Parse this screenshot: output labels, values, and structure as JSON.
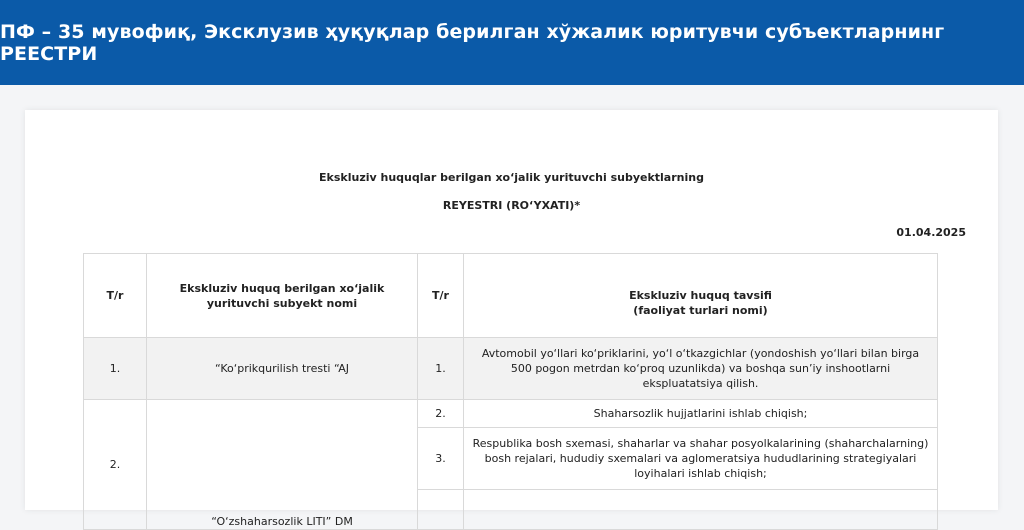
{
  "header": {
    "title": "ПФ – 35 мувофиқ, Эксклузив ҳуқуқлар берилган хўжалик юритувчи субъектларнинг РЕЕСТРИ"
  },
  "document": {
    "title_line1": "Eksklюziv huquqlar berilgan xo‘jalik yurituvchi subyektlarning",
    "title_line2": "REYESTRI (RO‘YXATI)*",
    "date": "01.04.2025"
  },
  "table": {
    "headers": {
      "num1": "T/r",
      "subject": "Eksklюziv huquq berilgan xo‘jalik yurituvchi subyekt nomi",
      "num2": "T/r",
      "description": "Eksklюziv huquq tavsifi\n(faoliyat turlari nomi)"
    },
    "rows": [
      {
        "num": "1.",
        "subject": "“Ko‘prikqurilish tresti “AJ",
        "items": [
          {
            "num": "1.",
            "text": "Avtomobil yo‘llari ko‘priklarini, yo‘l o‘tkazgichlar (yondoshish yo‘llari bilan birga 500 pogon metrdan ko‘proq uzunlikda) va boshqa sun’iy inshootlarni ekspluatatsiya qilish."
          }
        ]
      },
      {
        "num": "2.",
        "subject": "“O‘zshaharsozlik LITI” DM",
        "items": [
          {
            "num": "2.",
            "text": "Shaharsozlik hujjatlarini ishlab chiqish;"
          },
          {
            "num": "3.",
            "text": "Respublika bosh sxemasi, shaharlar va shahar posyolkalarining (shaharchalarning) bosh rejalari, hududiy sxemalari va aglomeratsiya hududlarining strategiyalari loyihalari ishlab chiqish;"
          }
        ]
      }
    ]
  }
}
